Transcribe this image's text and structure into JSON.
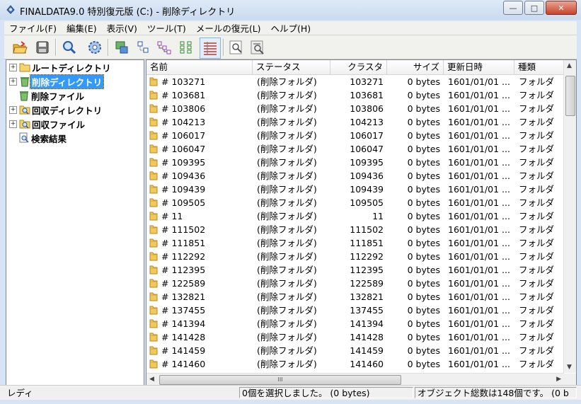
{
  "window": {
    "title": "FINALDATA9.0 特別復元版 (C:) - 削除ディレクトリ",
    "minimize": "—",
    "maximize": "□",
    "close": "✕"
  },
  "menu": [
    "ファイル(F)",
    "編集(E)",
    "表示(V)",
    "ツール(T)",
    "メールの復元(L)",
    "ヘルプ(H)"
  ],
  "toolbar": {
    "buttons": [
      "open-folder-icon",
      "save-disk-icon",
      "search-icon",
      "settings-gear-icon",
      "image-view-icon",
      "small-icons-view-icon",
      "list-view-icon",
      "tree-view-icon",
      "details-view-icon",
      "find-icon",
      "find-next-icon"
    ]
  },
  "tree": {
    "items": [
      {
        "label": "ルートディレクトリ",
        "expander": "+",
        "selected": false
      },
      {
        "label": "削除ディレクトリ",
        "expander": "+",
        "selected": true
      },
      {
        "label": "削除ファイル",
        "expander": "",
        "selected": false
      },
      {
        "label": "回収ディレクトリ",
        "expander": "+",
        "selected": false
      },
      {
        "label": "回収ファイル",
        "expander": "+",
        "selected": false
      },
      {
        "label": "検索結果",
        "expander": "",
        "selected": false
      }
    ]
  },
  "list": {
    "columns": [
      "名前",
      "ステータス",
      "クラスタ",
      "サイズ",
      "更新日時",
      "種類"
    ],
    "rows": [
      {
        "name": "# 103271",
        "status": "(削除フォルダ)",
        "cluster": "103271",
        "size": "0 bytes",
        "date": "1601/01/01 ...",
        "type": "フォルダ"
      },
      {
        "name": "# 103681",
        "status": "(削除フォルダ)",
        "cluster": "103681",
        "size": "0 bytes",
        "date": "1601/01/01 ...",
        "type": "フォルダ"
      },
      {
        "name": "# 103806",
        "status": "(削除フォルダ)",
        "cluster": "103806",
        "size": "0 bytes",
        "date": "1601/01/01 ...",
        "type": "フォルダ"
      },
      {
        "name": "# 104213",
        "status": "(削除フォルダ)",
        "cluster": "104213",
        "size": "0 bytes",
        "date": "1601/01/01 ...",
        "type": "フォルダ"
      },
      {
        "name": "# 106017",
        "status": "(削除フォルダ)",
        "cluster": "106017",
        "size": "0 bytes",
        "date": "1601/01/01 ...",
        "type": "フォルダ"
      },
      {
        "name": "# 106047",
        "status": "(削除フォルダ)",
        "cluster": "106047",
        "size": "0 bytes",
        "date": "1601/01/01 ...",
        "type": "フォルダ"
      },
      {
        "name": "# 109395",
        "status": "(削除フォルダ)",
        "cluster": "109395",
        "size": "0 bytes",
        "date": "1601/01/01 ...",
        "type": "フォルダ"
      },
      {
        "name": "# 109436",
        "status": "(削除フォルダ)",
        "cluster": "109436",
        "size": "0 bytes",
        "date": "1601/01/01 ...",
        "type": "フォルダ"
      },
      {
        "name": "# 109439",
        "status": "(削除フォルダ)",
        "cluster": "109439",
        "size": "0 bytes",
        "date": "1601/01/01 ...",
        "type": "フォルダ"
      },
      {
        "name": "# 109505",
        "status": "(削除フォルダ)",
        "cluster": "109505",
        "size": "0 bytes",
        "date": "1601/01/01 ...",
        "type": "フォルダ"
      },
      {
        "name": "# 11",
        "status": "(削除フォルダ)",
        "cluster": "11",
        "size": "0 bytes",
        "date": "1601/01/01 ...",
        "type": "フォルダ"
      },
      {
        "name": "# 111502",
        "status": "(削除フォルダ)",
        "cluster": "111502",
        "size": "0 bytes",
        "date": "1601/01/01 ...",
        "type": "フォルダ"
      },
      {
        "name": "# 111851",
        "status": "(削除フォルダ)",
        "cluster": "111851",
        "size": "0 bytes",
        "date": "1601/01/01 ...",
        "type": "フォルダ"
      },
      {
        "name": "# 112292",
        "status": "(削除フォルダ)",
        "cluster": "112292",
        "size": "0 bytes",
        "date": "1601/01/01 ...",
        "type": "フォルダ"
      },
      {
        "name": "# 112395",
        "status": "(削除フォルダ)",
        "cluster": "112395",
        "size": "0 bytes",
        "date": "1601/01/01 ...",
        "type": "フォルダ"
      },
      {
        "name": "# 122589",
        "status": "(削除フォルダ)",
        "cluster": "122589",
        "size": "0 bytes",
        "date": "1601/01/01 ...",
        "type": "フォルダ"
      },
      {
        "name": "# 132821",
        "status": "(削除フォルダ)",
        "cluster": "132821",
        "size": "0 bytes",
        "date": "1601/01/01 ...",
        "type": "フォルダ"
      },
      {
        "name": "# 137455",
        "status": "(削除フォルダ)",
        "cluster": "137455",
        "size": "0 bytes",
        "date": "1601/01/01 ...",
        "type": "フォルダ"
      },
      {
        "name": "# 141394",
        "status": "(削除フォルダ)",
        "cluster": "141394",
        "size": "0 bytes",
        "date": "1601/01/01 ...",
        "type": "フォルダ"
      },
      {
        "name": "# 141428",
        "status": "(削除フォルダ)",
        "cluster": "141428",
        "size": "0 bytes",
        "date": "1601/01/01 ...",
        "type": "フォルダ"
      },
      {
        "name": "# 141459",
        "status": "(削除フォルダ)",
        "cluster": "141459",
        "size": "0 bytes",
        "date": "1601/01/01 ...",
        "type": "フォルダ"
      },
      {
        "name": "# 141460",
        "status": "(削除フォルダ)",
        "cluster": "141460",
        "size": "0 bytes",
        "date": "1601/01/01 ...",
        "type": "フォルダ"
      }
    ],
    "hscroll_grip": "III"
  },
  "status": {
    "left": "レディ",
    "middle": "0個を選択しました。 (0 bytes)",
    "right": "オブジェクト総数は148個です。 (0 b"
  }
}
